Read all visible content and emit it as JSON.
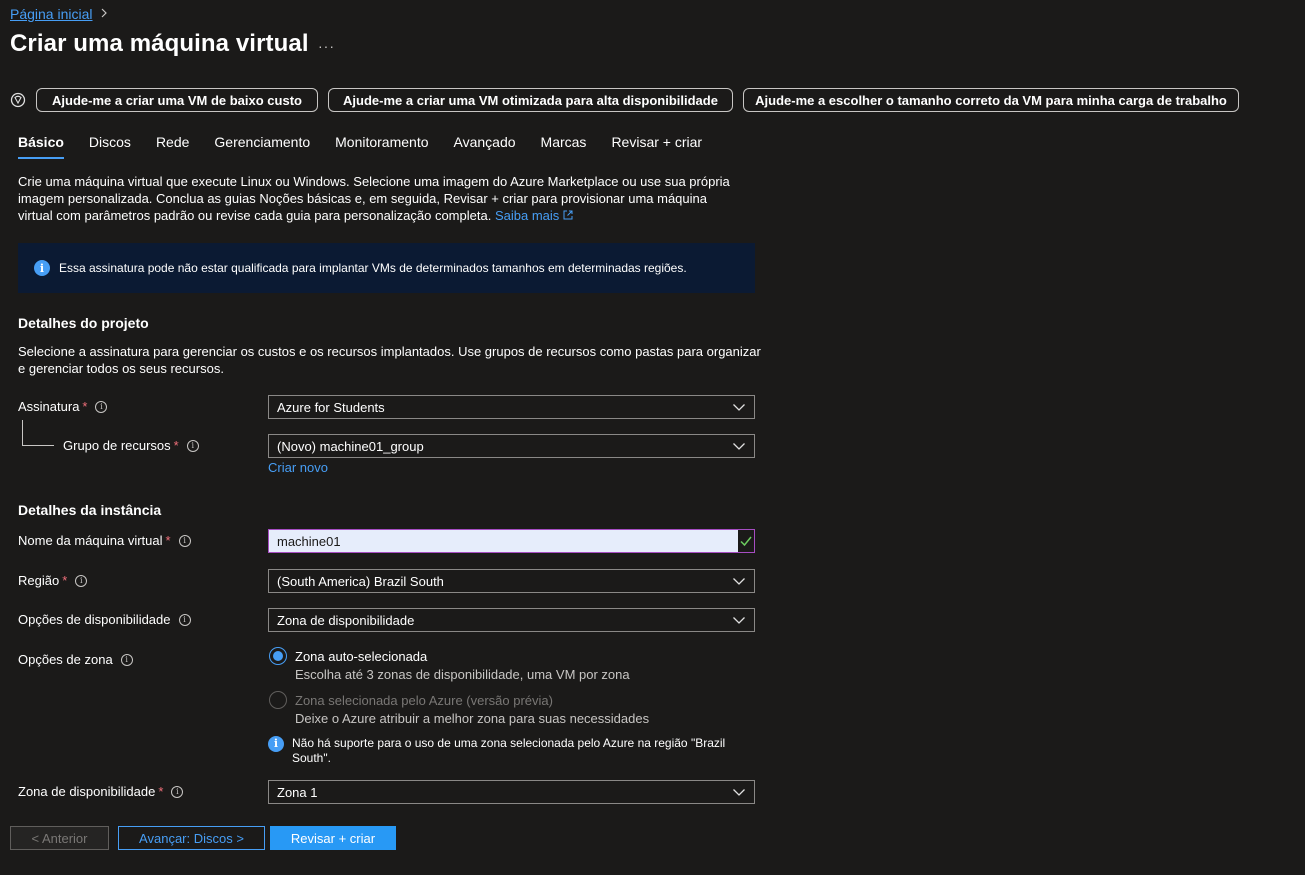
{
  "breadcrumb": {
    "home": "Página inicial"
  },
  "page": {
    "title": "Criar uma máquina virtual",
    "more": "···"
  },
  "copilot": {
    "buttons": [
      "Ajude-me a criar uma VM de baixo custo",
      "Ajude-me a criar uma VM otimizada para alta disponibilidade",
      "Ajude-me a escolher o tamanho correto da VM para minha carga de trabalho"
    ]
  },
  "tabs": [
    "Básico",
    "Discos",
    "Rede",
    "Gerenciamento",
    "Monitoramento",
    "Avançado",
    "Marcas",
    "Revisar + criar"
  ],
  "intro": {
    "text": "Crie uma máquina virtual que execute Linux ou Windows. Selecione uma imagem do Azure Marketplace ou use sua própria imagem personalizada. Conclua as guias Noções básicas e, em seguida, Revisar + criar para provisionar uma máquina virtual com parâmetros padrão ou revise cada guia para personalização completa.",
    "link": "Saiba mais"
  },
  "banner": {
    "text": "Essa assinatura pode não estar qualificada para implantar VMs de determinados tamanhos em determinadas regiões."
  },
  "project": {
    "title": "Detalhes do projeto",
    "desc": "Selecione a assinatura para gerenciar os custos e os recursos implantados. Use grupos de recursos como pastas para organizar e gerenciar todos os seus recursos.",
    "subscription_label": "Assinatura",
    "subscription_value": "Azure for Students",
    "rg_label": "Grupo de recursos",
    "rg_value": "(Novo) machine01_group",
    "create_new": "Criar novo"
  },
  "instance": {
    "title": "Detalhes da instância",
    "vm_name_label": "Nome da máquina virtual",
    "vm_name_value": "machine01",
    "region_label": "Região",
    "region_value": "(South America) Brazil South",
    "availability_label": "Opções de disponibilidade",
    "availability_value": "Zona de disponibilidade",
    "zone_options_label": "Opções de zona",
    "zone_option_1_title": "Zona auto-selecionada",
    "zone_option_1_sub": "Escolha até 3 zonas de disponibilidade, uma VM por zona",
    "zone_option_2_title": "Zona selecionada pelo Azure (versão prévia)",
    "zone_option_2_sub": "Deixe o Azure atribuir a melhor zona para suas necessidades",
    "zone_note": "Não há suporte para o uso de uma zona selecionada pelo Azure na região \"Brazil South\".",
    "zone_label": "Zona de disponibilidade",
    "zone_value": "Zona 1"
  },
  "footer": {
    "prev": "< Anterior",
    "next": "Avançar: Discos >",
    "review": "Revisar + criar"
  },
  "colors": {
    "accent": "#479ef5",
    "primary_button": "#2899f5",
    "required": "#f1707b",
    "banner_bg": "#0b1a33"
  }
}
